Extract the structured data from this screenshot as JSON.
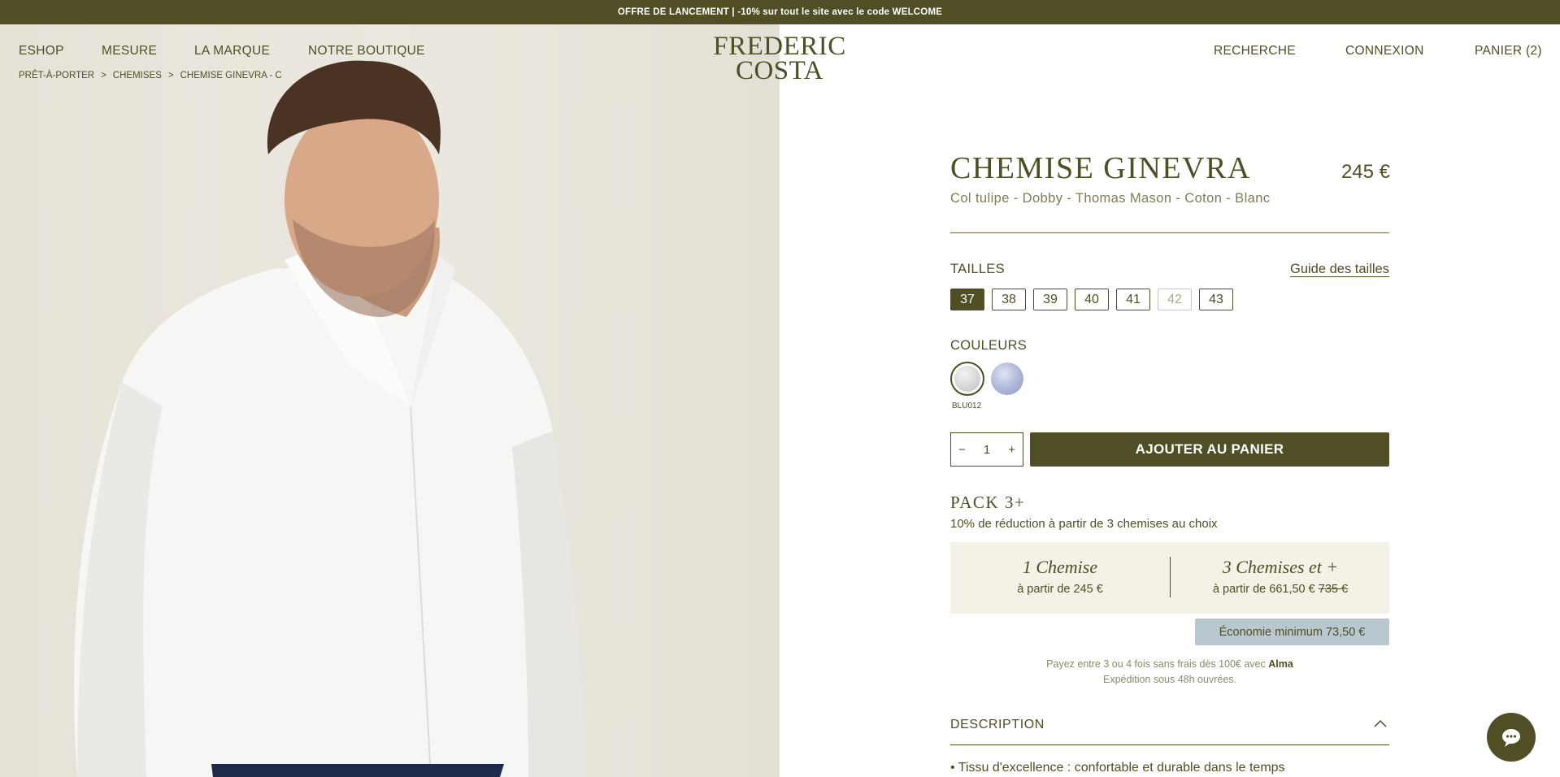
{
  "announcement": "OFFRE DE LANCEMENT | -10% sur tout le site avec le code WELCOME",
  "nav_left": [
    "ESHOP",
    "MESURE",
    "LA MARQUE",
    "NOTRE BOUTIQUE"
  ],
  "logo": {
    "line1": "FREDERIC",
    "line2": "COSTA"
  },
  "nav_right": {
    "search": "RECHERCHE",
    "login": "CONNEXION",
    "cart": "PANIER (2)"
  },
  "breadcrumb": {
    "items": [
      "PRÊT-À-PORTER",
      "CHEMISES",
      "CHEMISE GINEVRA - C"
    ],
    "separator": ">"
  },
  "product": {
    "title": "CHEMISE GINEVRA",
    "price": "245 €",
    "subtitle": "Col tulipe - Dobby - Thomas Mason - Coton - Blanc"
  },
  "sizes": {
    "label": "TAILLES",
    "guide": "Guide des tailles",
    "options": [
      "37",
      "38",
      "39",
      "40",
      "41",
      "42",
      "43"
    ],
    "selected": "37",
    "unavailable": [
      "42"
    ]
  },
  "colors": {
    "label": "COULEURS",
    "selected_code": "BLU012",
    "swatches": [
      {
        "name": "white-swatch",
        "color": "#d6d6d6"
      },
      {
        "name": "blue-swatch",
        "color": "#a4acd2"
      }
    ]
  },
  "quantity": {
    "minus": "−",
    "value": "1",
    "plus": "+"
  },
  "add_to_cart": "AJOUTER AU PANIER",
  "pack": {
    "title": "PACK 3+",
    "subtitle": "10% de réduction à partir de 3 chemises au choix",
    "single": {
      "label": "1 Chemise",
      "price": "à partir de 245 €"
    },
    "multi": {
      "label": "3 Chemises et +",
      "price": "à partir de 661,50 €",
      "old_price": "735 €"
    },
    "saving": "Économie minimum 73,50 €"
  },
  "payment": {
    "line1": "Payez entre 3 ou 4 fois sans frais dès 100€ avec",
    "provider": "Alma",
    "line2": "Expédition sous 48h ouvrées."
  },
  "description": {
    "label": "DESCRIPTION",
    "bullet": "• Tissu d'excellence : confortable et durable dans le temps"
  },
  "colors_theme": {
    "brand": "#4f4e25",
    "saving_bg": "#b9c7cf",
    "pack_bg": "#f4f2e6"
  }
}
